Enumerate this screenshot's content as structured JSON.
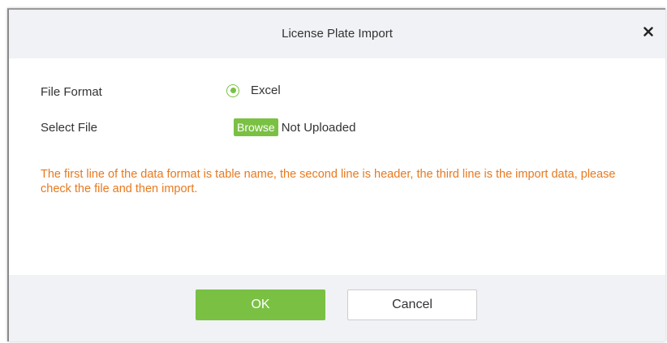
{
  "dialog": {
    "title": "License Plate Import",
    "close_icon": "close-icon"
  },
  "form": {
    "file_format_label": "File Format",
    "file_format_option": "Excel",
    "file_format_selected": true,
    "select_file_label": "Select File",
    "browse_label": "Browse",
    "file_status": "Not Uploaded"
  },
  "note": "The first line of the data format is table name, the second line is header, the third line is the import data, please check the file and then import.",
  "footer": {
    "ok_label": "OK",
    "cancel_label": "Cancel"
  },
  "colors": {
    "accent": "#7ac143",
    "note_text": "#e8791e",
    "header_bg": "#f0f2f5"
  }
}
